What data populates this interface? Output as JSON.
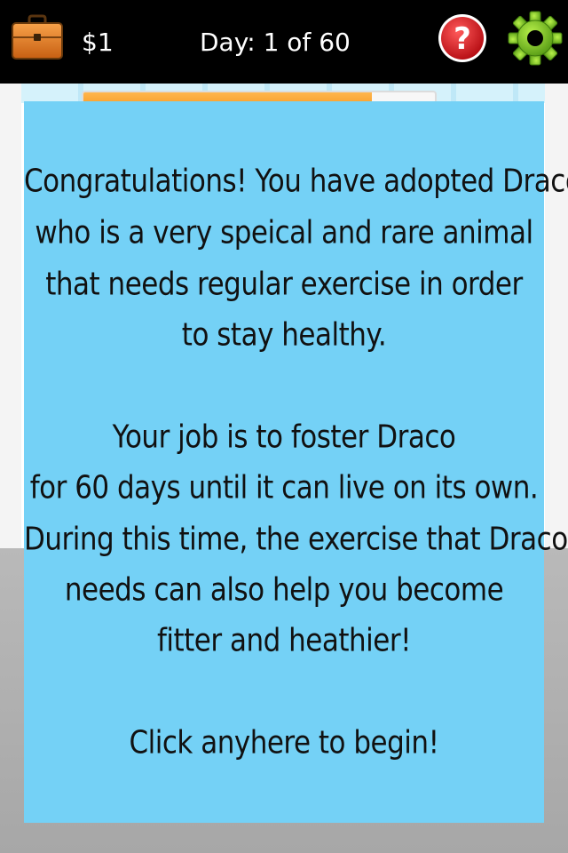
{
  "top_bar": {
    "money": "$1",
    "day": "Day: 1 of 60",
    "help_symbol": "?",
    "icons": {
      "briefcase": "briefcase-icon",
      "help": "help-icon",
      "settings": "gear-icon"
    }
  },
  "scene": {
    "progress_fraction": 0.82
  },
  "dialog": {
    "lines": [
      "Congratulations! You have adopted Draco",
      "who is a very speical and rare animal",
      "that needs regular exercise in order",
      "to stay healthy.",
      "",
      "Your job is to foster Draco",
      "for 60 days until it can live on its own.",
      "During this time, the exercise that Draco",
      "needs can also help you become",
      "fitter and heathier!",
      "",
      "Click anyhere to begin!"
    ]
  },
  "colors": {
    "top_bar": "#000000",
    "dialog_background": "#74d1f6",
    "progress_fill": "#f59a23",
    "help_red": "#d0141b",
    "gear_green": "#7cc61f",
    "briefcase_orange": "#e07a1e",
    "floor_gray": "#b3b3b3"
  }
}
